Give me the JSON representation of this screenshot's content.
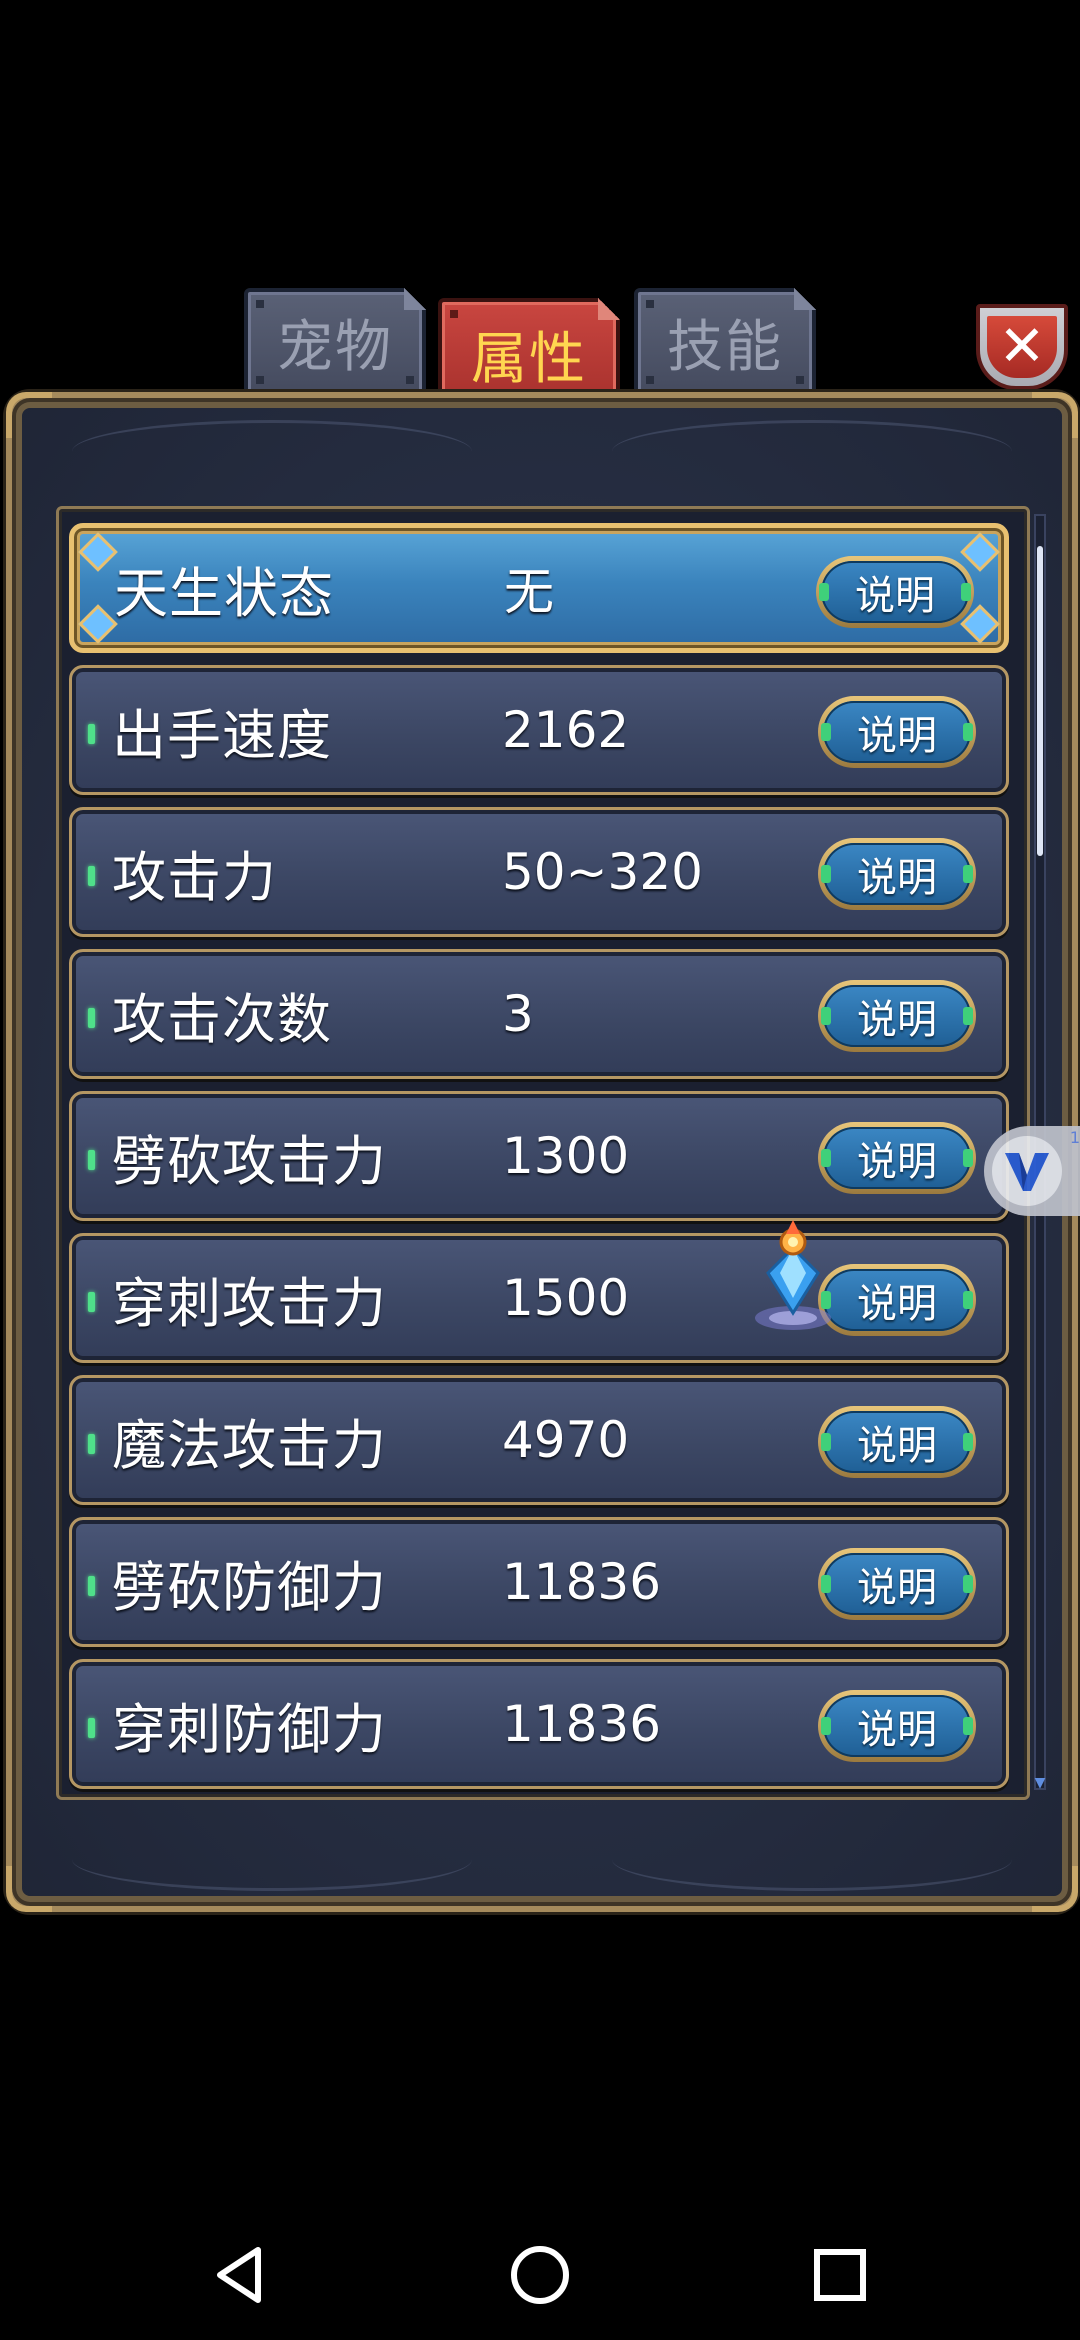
{
  "tabs": [
    {
      "label": "宠物",
      "active": false
    },
    {
      "label": "属性",
      "active": true
    },
    {
      "label": "技能",
      "active": false
    }
  ],
  "close_icon": "close-icon",
  "attributes": [
    {
      "name": "天生状态",
      "value": "无",
      "button": "说明",
      "selected": true
    },
    {
      "name": "出手速度",
      "value": "2162",
      "button": "说明",
      "selected": false
    },
    {
      "name": "攻击力",
      "value": "50~320",
      "button": "说明",
      "selected": false
    },
    {
      "name": "攻击次数",
      "value": "3",
      "button": "说明",
      "selected": false
    },
    {
      "name": "劈砍攻击力",
      "value": "1300",
      "button": "说明",
      "selected": false
    },
    {
      "name": "穿刺攻击力",
      "value": "1500",
      "button": "说明",
      "selected": false
    },
    {
      "name": "魔法攻击力",
      "value": "4970",
      "button": "说明",
      "selected": false
    },
    {
      "name": "劈砍防御力",
      "value": "11836",
      "button": "说明",
      "selected": false
    },
    {
      "name": "穿刺防御力",
      "value": "11836",
      "button": "说明",
      "selected": false
    }
  ],
  "scroll_position": 0.0,
  "floating_widget": {
    "badge": "1",
    "icon": "v-logo-icon"
  },
  "navbar": {
    "back": "back-icon",
    "home": "home-icon",
    "recents": "recents-icon"
  },
  "colors": {
    "tab_active_bg": "#b8382f",
    "tab_active_text": "#ffd650",
    "row_selected_bg": "#3b84bd",
    "frame_gold": "#b59763",
    "marker_green": "#4fe08a"
  }
}
